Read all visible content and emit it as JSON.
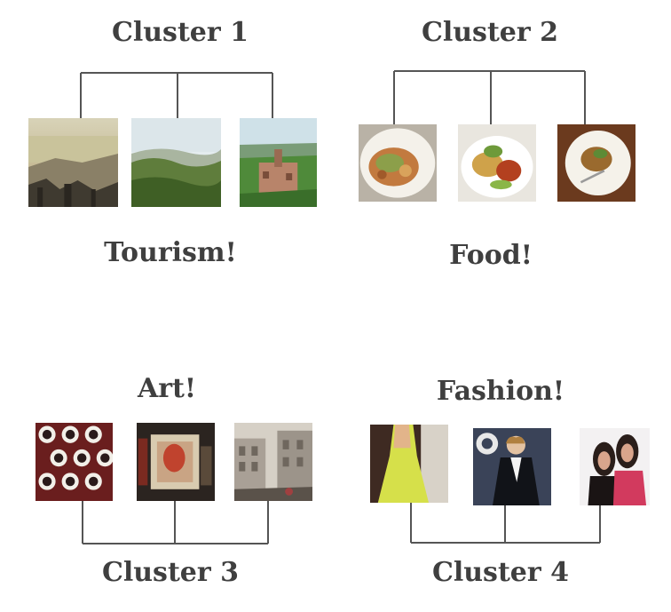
{
  "clusters": [
    {
      "title": "Cluster 1",
      "caption": "Tourism!",
      "photos": [
        {
          "icon": "city-skyline-icon",
          "subject": "aerial city view"
        },
        {
          "icon": "hills-landscape-icon",
          "subject": "green hills landscape"
        },
        {
          "icon": "hilltop-town-icon",
          "subject": "hilltop town"
        }
      ]
    },
    {
      "title": "Cluster 2",
      "caption": "Food!",
      "photos": [
        {
          "icon": "plated-dish-icon",
          "subject": "plated dish"
        },
        {
          "icon": "plated-dish-icon",
          "subject": "plated dish"
        },
        {
          "icon": "plated-dish-icon",
          "subject": "plated dish"
        }
      ]
    },
    {
      "title": "Cluster 3",
      "caption": "Art!",
      "photos": [
        {
          "icon": "paint-cups-icon",
          "subject": "paint cups"
        },
        {
          "icon": "painting-icon",
          "subject": "painting"
        },
        {
          "icon": "street-buildings-icon",
          "subject": "street with buildings"
        }
      ]
    },
    {
      "title": "Cluster 4",
      "caption": "Fashion!",
      "photos": [
        {
          "icon": "yellow-dress-icon",
          "subject": "yellow dress"
        },
        {
          "icon": "tuxedo-man-icon",
          "subject": "man in tuxedo"
        },
        {
          "icon": "two-women-icon",
          "subject": "two women"
        }
      ]
    }
  ],
  "colors": {
    "text": "#3f3f3f",
    "connector": "#555555",
    "background": "#ffffff"
  }
}
